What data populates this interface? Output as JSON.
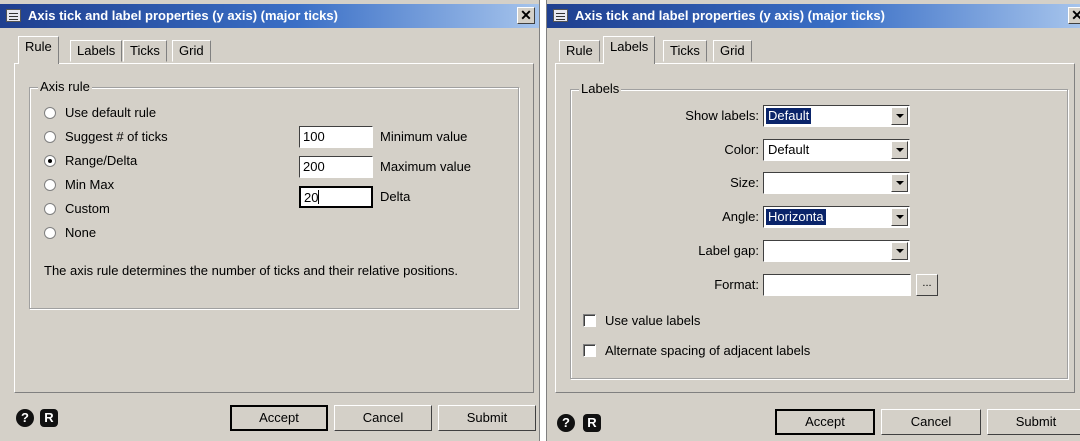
{
  "dialog_left": {
    "title": "Axis tick and label properties (y axis) (major ticks)",
    "close": "✕",
    "tabs": [
      "Rule",
      "Labels",
      "Ticks",
      "Grid"
    ],
    "active_tab": "Rule",
    "group_label": "Axis rule",
    "radios": [
      {
        "label": "Use default rule",
        "checked": false
      },
      {
        "label": "Suggest # of ticks",
        "checked": false
      },
      {
        "label": "Range/Delta",
        "checked": true
      },
      {
        "label": "Min Max",
        "checked": false
      },
      {
        "label": "Custom",
        "checked": false
      },
      {
        "label": "None",
        "checked": false
      }
    ],
    "fields": [
      {
        "value": "100",
        "label": "Minimum value"
      },
      {
        "value": "200",
        "label": "Maximum value"
      },
      {
        "value": "20",
        "label": "Delta"
      }
    ],
    "help_text": "The axis rule determines the number of ticks and their relative positions.",
    "icons": {
      "help": "?",
      "record": "R"
    },
    "buttons": {
      "accept": "Accept",
      "cancel": "Cancel",
      "submit": "Submit"
    }
  },
  "dialog_right": {
    "title": "Axis tick and label properties (y axis) (major ticks)",
    "close": "✕",
    "tabs": [
      "Rule",
      "Labels",
      "Ticks",
      "Grid"
    ],
    "active_tab": "Labels",
    "group_label": "Labels",
    "rows": [
      {
        "label": "Show labels:",
        "value": "Default"
      },
      {
        "label": "Color:",
        "value": "Default"
      },
      {
        "label": "Size:",
        "value": ""
      },
      {
        "label": "Angle:",
        "value": "Horizonta"
      },
      {
        "label": "Label gap:",
        "value": ""
      },
      {
        "label": "Format:",
        "value": ""
      }
    ],
    "format_button": "...",
    "checkboxes": [
      {
        "label": "Use value labels",
        "checked": false
      },
      {
        "label": "Alternate spacing of adjacent labels",
        "checked": false
      }
    ],
    "icons": {
      "help": "?",
      "record": "R"
    },
    "buttons": {
      "accept": "Accept",
      "cancel": "Cancel",
      "submit": "Submit"
    }
  }
}
